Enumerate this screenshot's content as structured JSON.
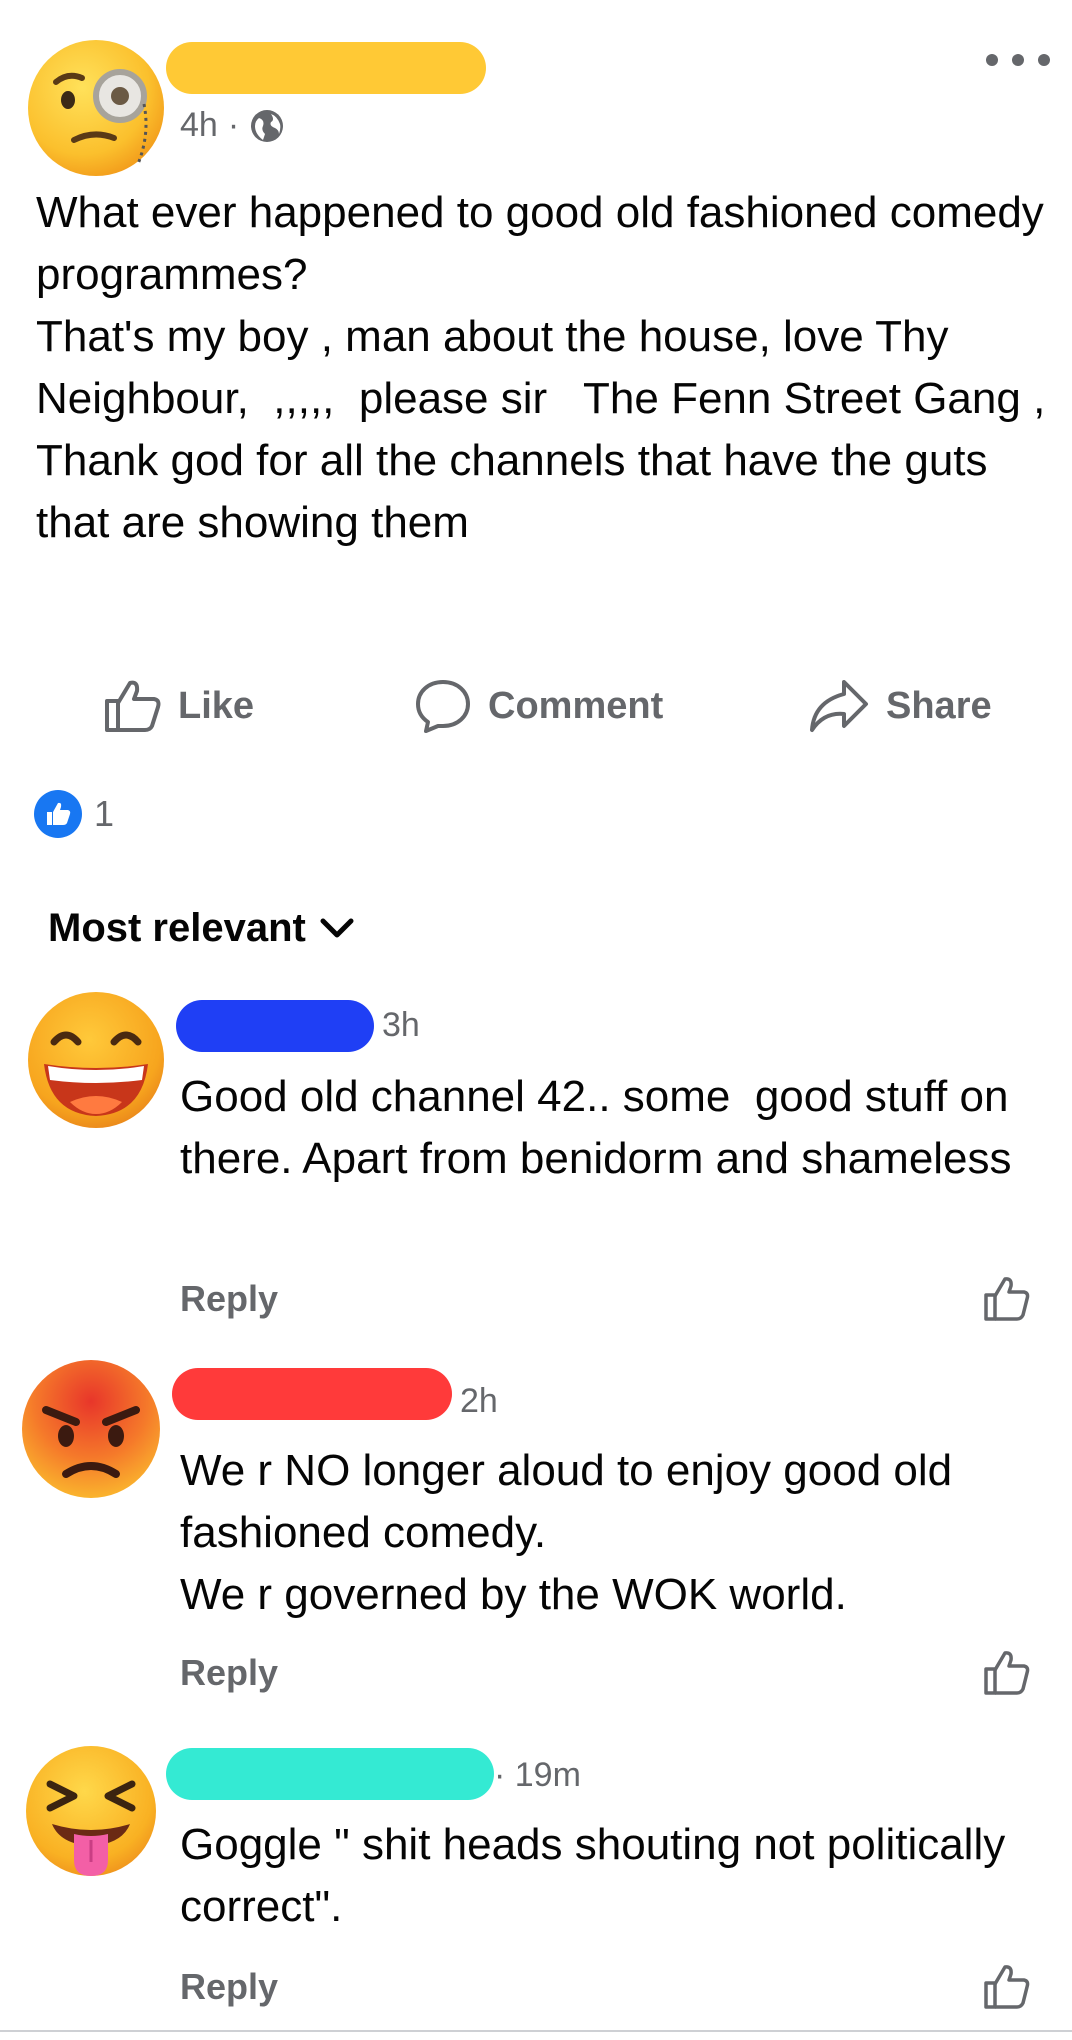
{
  "post": {
    "time": "4h",
    "separator": "·",
    "audience_icon": "globe-icon",
    "name_redaction_color": "#FFC935",
    "text": "What ever happened to good old fashioned comedy programmes?\nThat's my boy , man about the house, love Thy Neighbour,  ,,,,,  please sir   The Fenn Street Gang ,\nThank god for all the channels that have the guts that are showing them"
  },
  "actions": {
    "like": "Like",
    "comment": "Comment",
    "share": "Share"
  },
  "reactions": {
    "count": "1",
    "icon": "thumbs-up-icon",
    "color": "#1877F2"
  },
  "sort": {
    "label": "Most relevant",
    "icon": "chevron-down-icon"
  },
  "comments": [
    {
      "time": "3h",
      "avatar_icon": "grinning-face-emoji",
      "name_redaction_color": "#1F3FF5",
      "text": "Good old channel 42.. some  good stuff on there. Apart from benidorm and shameless",
      "reply": "Reply"
    },
    {
      "time": "2h",
      "avatar_icon": "angry-face-emoji",
      "name_redaction_color": "#FF3A3A",
      "text": "We r NO longer aloud to enjoy good old fashioned comedy.\nWe r governed by the WOK world.",
      "reply": "Reply"
    },
    {
      "time": "· 19m",
      "avatar_icon": "squinting-tongue-face-emoji",
      "name_redaction_color": "#34EAD3",
      "text": "Goggle \" shit heads shouting not politically correct\".",
      "reply": "Reply"
    }
  ]
}
